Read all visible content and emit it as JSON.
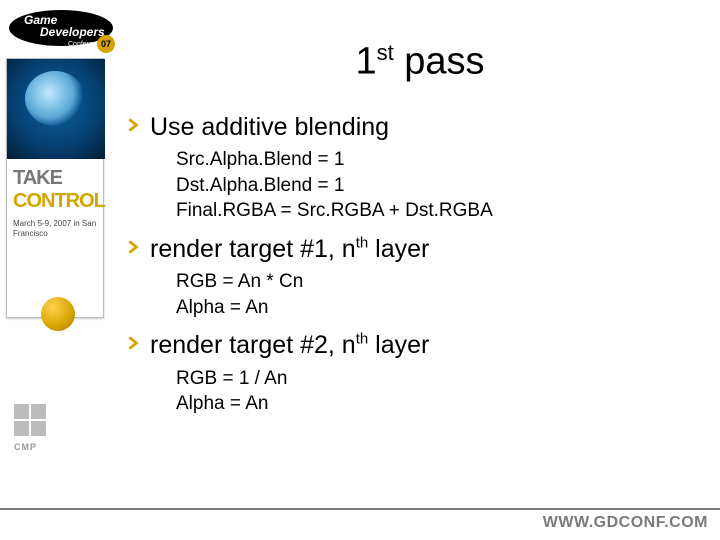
{
  "title": {
    "prefix": "1",
    "ordinal": "st",
    "rest": " pass"
  },
  "bullets": [
    {
      "label": "Use additive blending",
      "sub": [
        "Src.Alpha.Blend = 1",
        "Dst.Alpha.Blend = 1",
        "Final.RGBA = Src.RGBA + Dst.RGBA"
      ]
    },
    {
      "label_before": "render target #1, n",
      "sup": "th",
      "label_after": " layer",
      "sub": [
        "RGB = An * Cn",
        "Alpha = An"
      ]
    },
    {
      "label_before": "render target #2, n",
      "sup": "th",
      "label_after": " layer",
      "sub": [
        "RGB = 1 / An",
        "Alpha = An"
      ]
    }
  ],
  "sidebar": {
    "conference_top": "Game",
    "conference_bottom": "Developers",
    "conference_sub": "Conference",
    "year": "07",
    "take": "TAKE",
    "control": "CONTROL",
    "date": "March 5-9, 2007 in San Francisco"
  },
  "footer": {
    "cmp": "CMP",
    "url": "WWW.GDCONF.COM"
  },
  "colors": {
    "bullet": "#d6a400",
    "footer_line": "#7a7a7a"
  }
}
